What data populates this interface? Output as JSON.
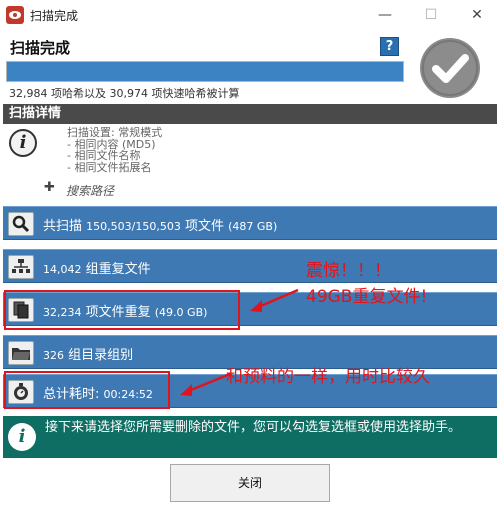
{
  "window": {
    "title": "扫描完成",
    "minimize": "—",
    "maximize": "☐",
    "close": "✕"
  },
  "header": {
    "title": "扫描完成",
    "help_label": "?",
    "progress_fraction": 1.0,
    "progress_text": "32,984 项哈希以及 30,974 项快速哈希被计算"
  },
  "details": {
    "section_title": "扫描详情",
    "info_glyph": "i",
    "settings_lines": [
      "扫描设置: 常规模式",
      "- 相同内容 (MD5)",
      "- 相同文件名称",
      "- 相同文件拓展名"
    ],
    "search_path_label": "搜索路径"
  },
  "results": [
    {
      "icon": "magnifier-icon",
      "text": "共扫描 ",
      "small": "150,503/150,503",
      "text2": " 项文件 ",
      "small2": "(487 GB)"
    },
    {
      "icon": "duplicate-groups-icon",
      "text": "",
      "small": "14,042",
      "text2": " 组重复文件",
      "small2": ""
    },
    {
      "icon": "duplicate-files-icon",
      "text": "",
      "small": "32,234",
      "text2": " 项文件重复 ",
      "small2": "(49.0 GB)"
    },
    {
      "icon": "folder-icon",
      "text": "",
      "small": "326",
      "text2": " 组目录组别",
      "small2": ""
    },
    {
      "icon": "stopwatch-icon",
      "text": "总计耗时: ",
      "small": "00:24:52",
      "text2": "",
      "small2": ""
    }
  ],
  "hint": {
    "glyph": "i",
    "text": "接下来请选择您所需要删除的文件，您可以勾选复选框或使用选择助手。"
  },
  "footer": {
    "close_label": "关闭"
  },
  "annotations": {
    "shock_line1": "震惊！！！",
    "shock_line2": "49GB重复文件!",
    "time_note": "和预料的一样，用时比较久",
    "color": "#e0141c"
  }
}
